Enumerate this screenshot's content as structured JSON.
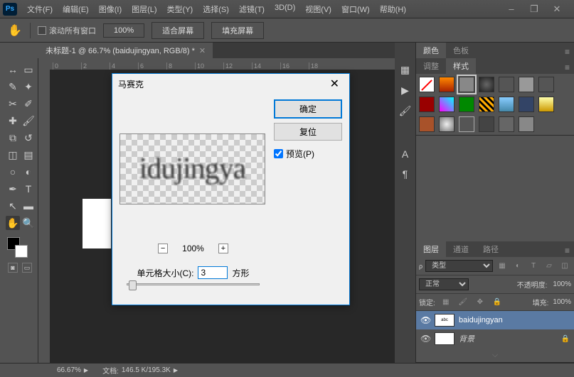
{
  "app": {
    "logo": "Ps"
  },
  "menu": [
    "文件(F)",
    "编辑(E)",
    "图像(I)",
    "图层(L)",
    "类型(Y)",
    "选择(S)",
    "滤镜(T)",
    "3D(D)",
    "视图(V)",
    "窗口(W)",
    "帮助(H)"
  ],
  "optbar": {
    "scroll_all": "滚动所有窗口",
    "zoom": "100%",
    "fit": "适合屏幕",
    "fill": "填充屏幕"
  },
  "doc": {
    "tab": "未标题-1 @ 66.7% (baidujingyan, RGB/8) *",
    "ruler_h": [
      "0",
      "2",
      "4",
      "6",
      "8",
      "10",
      "12",
      "14",
      "16",
      "18"
    ]
  },
  "dialog": {
    "title": "马赛克",
    "ok": "确定",
    "cancel": "复位",
    "preview_label": "预览(P)",
    "preview_text": "idujingya",
    "zoom": "100%",
    "cell_label": "单元格大小(C):",
    "cell_value": "3",
    "cell_unit": "方形"
  },
  "panels": {
    "color_tab": "颜色",
    "swatch_tab": "色板",
    "adjust_tab": "调整",
    "style_tab": "样式",
    "layers_tab": "图层",
    "channels_tab": "通道",
    "paths_tab": "路径",
    "kind_label": "类型",
    "blend_mode": "正常",
    "opacity_label": "不透明度:",
    "opacity_val": "100%",
    "lock_label": "锁定:",
    "fill_label": "填充:",
    "fill_val": "100%",
    "layer1": "baidujingyan",
    "layer2": "背景"
  },
  "status": {
    "zoom": "66.67%",
    "doc_label": "文档:",
    "doc_size": "146.5 K/195.3K"
  },
  "icons": {
    "hand": "✋",
    "minimize": "–",
    "restore": "❐",
    "close": "✕",
    "play": "▶",
    "char": "A",
    "para": "¶",
    "hist": "⟳",
    "swatch": "▦",
    "eye": "👁",
    "lock": "🔒",
    "menu": "≡"
  }
}
